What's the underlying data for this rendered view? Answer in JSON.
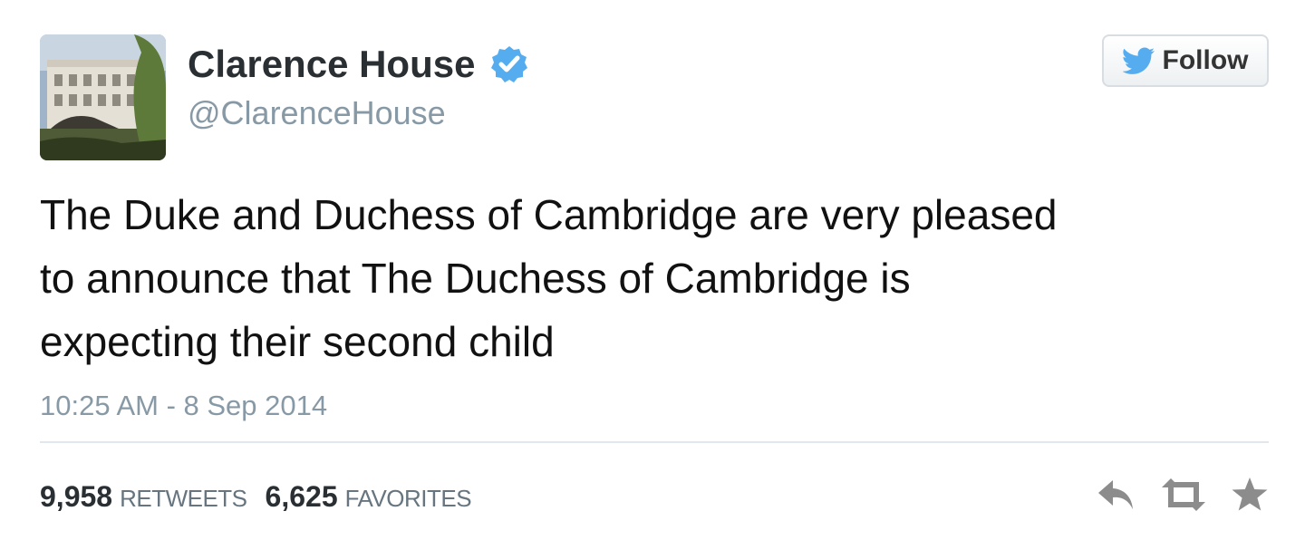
{
  "author": {
    "display_name": "Clarence House",
    "handle": "@ClarenceHouse",
    "verified": true
  },
  "follow_button": {
    "label": "Follow"
  },
  "tweet": {
    "text_lines": [
      "The Duke and Duchess of Cambridge are very pleased",
      "to announce that The Duchess of Cambridge is",
      "expecting their second child"
    ],
    "timestamp": "10:25 AM - 8 Sep 2014"
  },
  "stats": {
    "retweets": {
      "count": "9,958",
      "label": "RETWEETS"
    },
    "favorites": {
      "count": "6,625",
      "label": "FAVORITES"
    }
  },
  "icons": {
    "verified": "verified-badge-icon",
    "follow": "twitter-bird-icon",
    "reply": "reply-icon",
    "retweet": "retweet-icon",
    "favorite": "star-icon"
  },
  "colors": {
    "verified_badge": "#55acee",
    "bird": "#55acee",
    "action_icons": "#8c8c8c",
    "muted_text": "#8899a6"
  }
}
